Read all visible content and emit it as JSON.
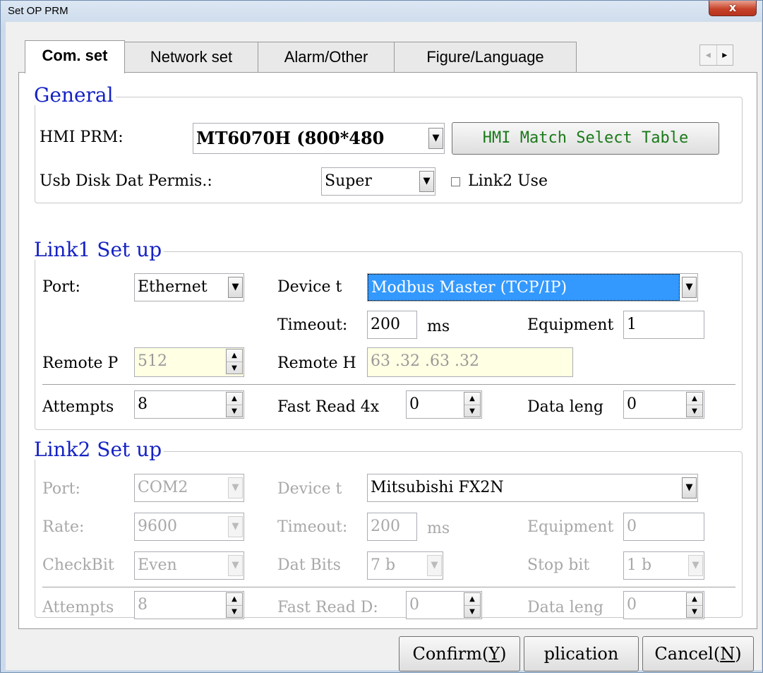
{
  "window": {
    "title": "Set OP PRM",
    "close_label": "x"
  },
  "tabs": [
    {
      "label": "Com. set",
      "active": true
    },
    {
      "label": "Network set",
      "active": false
    },
    {
      "label": "Alarm/Other",
      "active": false
    },
    {
      "label": "Figure/Language",
      "active": false
    }
  ],
  "tab_scroll": {
    "left": "◂",
    "right": "▸"
  },
  "general": {
    "title": "General",
    "hmi_prm_label": "HMI PRM:",
    "hmi_prm_value": "MT6070H (800*480",
    "hmi_match_button": "HMI Match Select Table",
    "usb_label": "Usb Disk Dat Permis.:",
    "usb_value": "Super",
    "link2_use_label": "Link2 Use",
    "link2_use_checked": false
  },
  "link1": {
    "title": "Link1 Set up",
    "port_label": "Port:",
    "port_value": "Ethernet",
    "device_label": "Device t",
    "device_value": "Modbus Master (TCP/IP)",
    "timeout_label": "Timeout:",
    "timeout_value": "200",
    "timeout_unit": "ms",
    "equipment_label": "Equipment",
    "equipment_value": "1",
    "remote_port_label": "Remote P",
    "remote_port_value": "512",
    "remote_host_label": "Remote H",
    "remote_host_value": "63 .32 .63 .32",
    "attempts_label": "Attempts",
    "attempts_value": "8",
    "fast_read_label": "Fast Read 4x",
    "fast_read_value": "0",
    "data_len_label": "Data leng",
    "data_len_value": "0"
  },
  "link2": {
    "title": "Link2 Set up",
    "port_label": "Port:",
    "port_value": "COM2",
    "device_label": "Device t",
    "device_value": "Mitsubishi FX2N",
    "rate_label": "Rate:",
    "rate_value": "9600",
    "timeout_label": "Timeout:",
    "timeout_value": "200",
    "timeout_unit": "ms",
    "equipment_label": "Equipment",
    "equipment_value": "0",
    "checkbit_label": "CheckBit",
    "checkbit_value": "Even",
    "datbits_label": "Dat Bits",
    "datbits_value": "7 b",
    "stopbit_label": "Stop bit",
    "stopbit_value": "1 b",
    "attempts_label": "Attempts",
    "attempts_value": "8",
    "fast_read_label": "Fast Read D:",
    "fast_read_value": "0",
    "data_len_label": "Data leng",
    "data_len_value": "0"
  },
  "buttons": {
    "confirm_text": "Confirm(",
    "confirm_key": "Y",
    "application_text": "plication",
    "cancel_text": "Cancel(",
    "cancel_key": "N",
    "close_paren": ")"
  },
  "icons": {
    "dropdown": "▼",
    "spin_up": "▲",
    "spin_down": "▼"
  },
  "colors": {
    "group_title": "#1522c4",
    "hmi_button_text": "#1a7a1a",
    "selection": "#3399ff",
    "readonly_bg": "#ffffe4"
  }
}
